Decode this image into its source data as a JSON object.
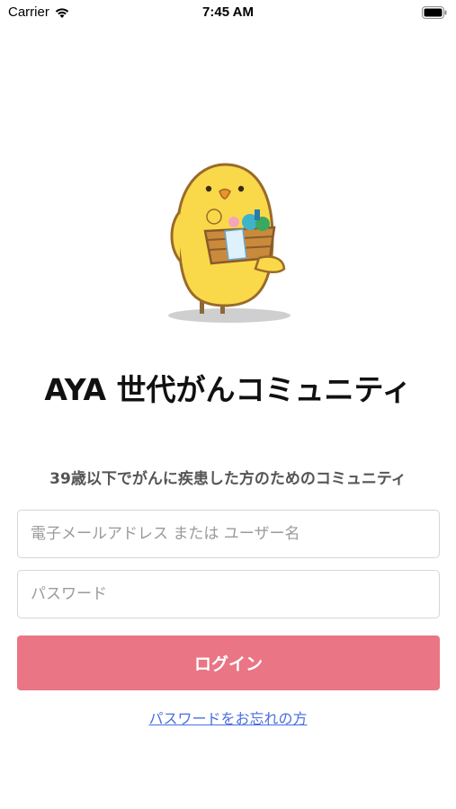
{
  "status_bar": {
    "carrier": "Carrier",
    "time": "7:45 AM",
    "wifi_icon": "wifi-icon",
    "battery_icon": "battery-icon"
  },
  "mascot": {
    "icon": "chick-mascot-icon"
  },
  "title": "AYA 世代がんコミュニティ",
  "subtitle": "39歳以下でがんに疾患した方のためのコミュニティ",
  "login_form": {
    "email_placeholder": "電子メールアドレス または ユーザー名",
    "email_value": "",
    "password_placeholder": "パスワード",
    "password_value": "",
    "login_label": "ログイン"
  },
  "forgot_password_label": "パスワードをお忘れの方",
  "colors": {
    "primary_button": "#e97585",
    "link": "#4a6ee0",
    "mascot_body": "#f9d94a"
  }
}
